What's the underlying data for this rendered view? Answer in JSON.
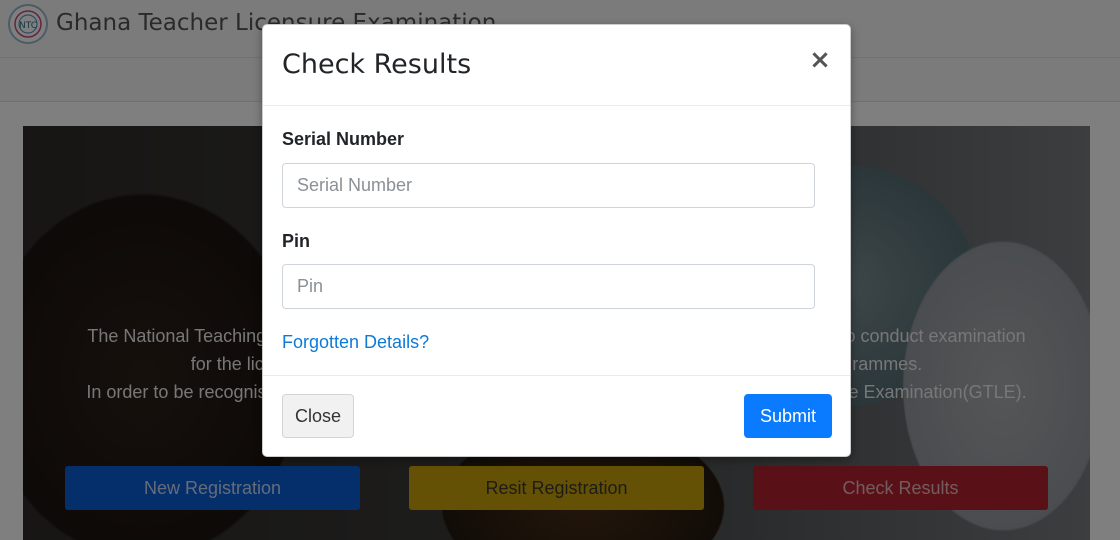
{
  "navbar": {
    "brand": "Ghana Teacher Licensure Examination",
    "logo_icon": "ntc-logo-icon"
  },
  "hero": {
    "line1": "The National Teaching Council is mandated by the Education Act 2008 (Act 778) section 60(b) to conduct examination",
    "line2": "for the licensure of teachers who have completed approved teacher education programmes.",
    "line3": "In order to be recognised as a professional teacher, you must pass the Ghana Teacher Licensure Examination(GTLE).",
    "buttons": {
      "new": "New Registration",
      "resit": "Resit Registration",
      "check": "Check Results"
    },
    "colors": {
      "new": "#0b5fd6",
      "resit": "#c9a20a",
      "check": "#b3222f"
    }
  },
  "modal": {
    "title": "Check Results",
    "close_glyph": "×",
    "serial_label": "Serial Number",
    "serial_placeholder": "Serial Number",
    "serial_value": "",
    "pin_label": "Pin",
    "pin_placeholder": "Pin",
    "pin_value": "",
    "forgot_link": "Forgotten Details?",
    "close_button": "Close",
    "submit_button": "Submit",
    "submit_color": "#0a7bff"
  }
}
